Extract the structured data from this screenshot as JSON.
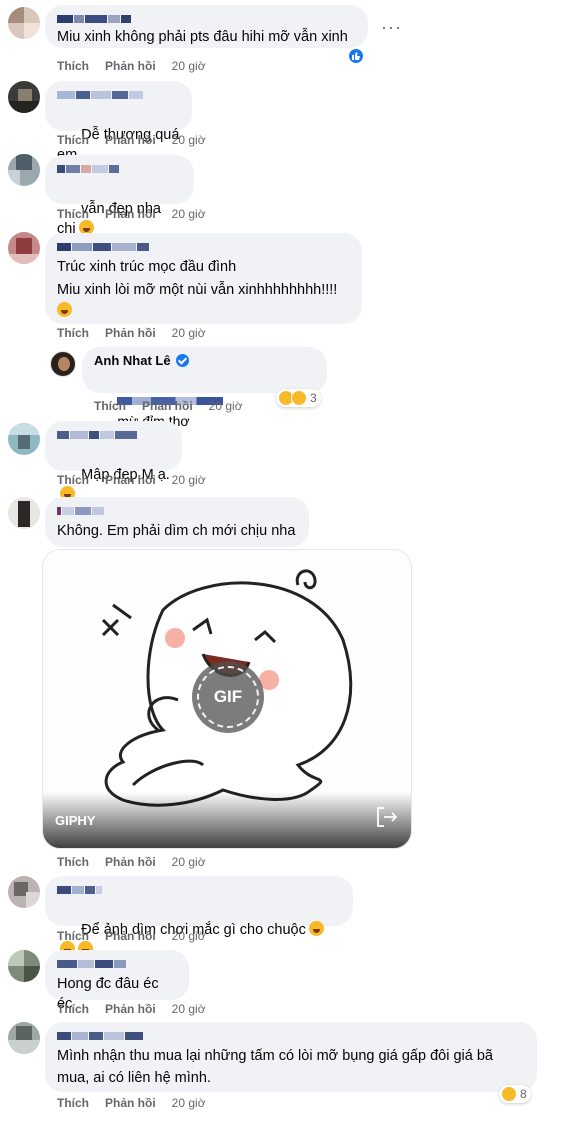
{
  "actions": {
    "like": "Thích",
    "reply": "Phản hồi"
  },
  "gif": {
    "label": "GIPHY",
    "badge": "GIF"
  },
  "comments": [
    {
      "text": "Miu xinh không phải pts đâu hihi mỡ vẫn xinh",
      "time": "20 giờ"
    },
    {
      "text": "Dễ thương quá em",
      "time": "20 giờ"
    },
    {
      "text": "vẫn đẹp nha chị",
      "time": "20 giờ"
    },
    {
      "line1": "Trúc xinh trúc mọc đầu đình",
      "line2": "Miu xinh lòi mỡ một nùi vẫn xinhhhhhhhh!!!!",
      "time": "20 giờ"
    },
    {
      "author": "Anh Nhat Lê",
      "text": "mừ đỉm thơ",
      "time": "20 giờ",
      "reactions": "3"
    },
    {
      "text": "Mập đẹp M ạ.",
      "time": "20 giờ"
    },
    {
      "text": "Không. Em phải dìm ch mới chịu nha",
      "time": "20 giờ"
    },
    {
      "text": "Để ảnh dìm chơi mắc gì cho chuộc",
      "time": "20 giờ"
    },
    {
      "text": "Hong đc đâu éc éc",
      "time": "20 giờ"
    },
    {
      "line1": "Mình nhận thu mua lại những tấm có lòi mỡ bụng giá gấp đôi giá bã",
      "line2": "mua, ai có liên hệ mình.",
      "time": "20 giờ",
      "reactions": "8"
    }
  ],
  "colors": {
    "bubble": "#f0f2f5",
    "meta": "#65676b",
    "brand": "#1877f2"
  }
}
